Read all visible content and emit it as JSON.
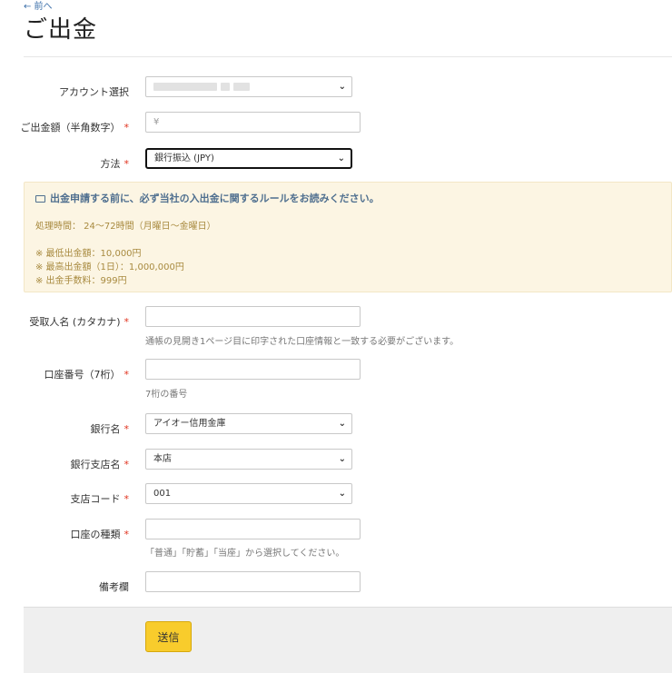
{
  "nav": {
    "back_label": "← 前へ"
  },
  "page": {
    "title": "ご出金"
  },
  "form": {
    "account": {
      "label": "アカウント選択",
      "value": ""
    },
    "amount": {
      "label": "ご出金額（半角数字）",
      "placeholder": "¥"
    },
    "method": {
      "label": "方法",
      "value": "銀行振込 (JPY)"
    },
    "recipient": {
      "label": "受取人名 (カタカナ)",
      "help": "通帳の見開き1ページ目に印字された口座情報と一致する必要がございます。"
    },
    "account_number": {
      "label": "口座番号（7桁）",
      "help": "7桁の番号"
    },
    "bank_name": {
      "label": "銀行名",
      "value": "アイオー信用金庫"
    },
    "branch_name": {
      "label": "銀行支店名",
      "value": "本店"
    },
    "branch_code": {
      "label": "支店コード",
      "value": "001"
    },
    "account_type": {
      "label": "口座の種類",
      "help": "「普通」「貯蓄」「当座」から選択してください。"
    },
    "remarks": {
      "label": "備考欄"
    },
    "required_mark": "*",
    "submit_label": "送信"
  },
  "notice": {
    "heading": "出金申請する前に、必ず当社の入出金に関するルールをお読みください。",
    "processing_time": "処理時間： 24〜72時間（月曜日〜金曜日）",
    "min_amount": "※ 最低出金額：10,000円",
    "max_amount": "※ 最高出金額（1日）：1,000,000円",
    "fee": "※ 出金手数料：999円"
  },
  "icons": {
    "dropdown": "chevron-down-icon",
    "notice": "book-icon"
  },
  "colors": {
    "required": "#e0321e",
    "notice_bg": "#fcf5e3",
    "notice_heading": "#4f6f8f",
    "notice_text": "#a88a3f",
    "submit_bg": "#f8cc2c"
  }
}
